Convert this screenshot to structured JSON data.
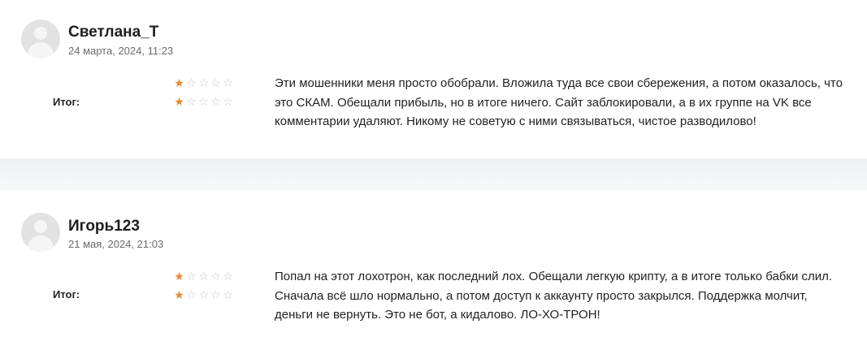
{
  "reviews": [
    {
      "author": "Светлана_Т",
      "date": "24 марта, 2024, 11:23",
      "total_label": "Итог:",
      "rating_rows": [
        1,
        1
      ],
      "max_stars": 5,
      "text": "Эти мошенники меня просто обобрали. Вложила туда все свои сбережения, а потом оказалось, что это СКАМ. Обещали прибыль, но в итоге ничего. Сайт заблокировали, а в их группе на VK все комментарии удаляют. Никому не советую с ними связываться, чистое разводилово!"
    },
    {
      "author": "Игорь123",
      "date": "21 мая, 2024, 21:03",
      "total_label": "Итог:",
      "rating_rows": [
        1,
        1
      ],
      "max_stars": 5,
      "text": "Попал на этот лохотрон, как последний лох. Обещали легкую крипту, а в итоге только бабки слил. Сначала всё шло нормально, а потом доступ к аккаунту просто закрылся. Поддержка молчит, деньги не вернуть. Это не бот, а кидалово. ЛО-ХО-ТРОН!"
    }
  ],
  "colors": {
    "star_on": "#e8892e",
    "star_off": "#c9c9c9"
  },
  "icons": {
    "avatar": "user-silhouette-icon",
    "star": "star-icon"
  }
}
